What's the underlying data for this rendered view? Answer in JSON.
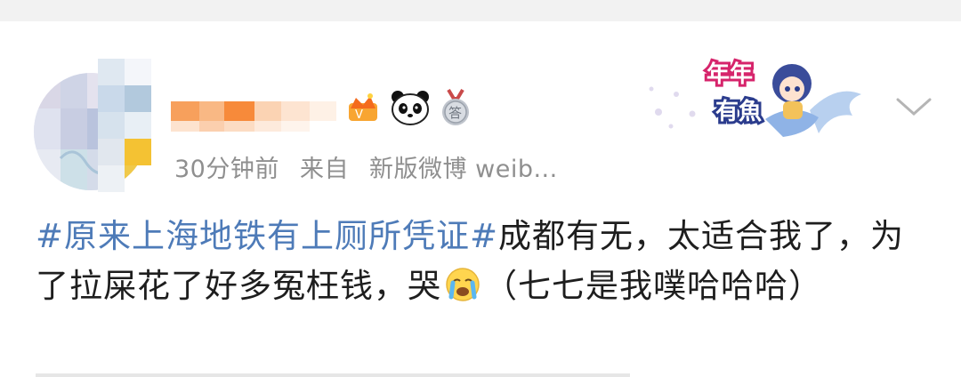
{
  "post": {
    "time": "30分钟前",
    "source_prefix": "来自",
    "source": "新版微博 weib...",
    "hashtag": "#原来上海地铁有上厕所凭证#",
    "text_part1": "成都有无，太适合我了，为了拉屎花了好多冤枉钱，哭",
    "text_part2": "（七七是我噗哈哈哈）",
    "emoji": "crying-face-icon"
  },
  "decoration": {
    "label": "年年有魚"
  },
  "badges": [
    "crown-icon",
    "panda-icon",
    "medal-icon"
  ],
  "colors": {
    "hashtag": "#4e7bb8",
    "meta": "#8f8f8f",
    "text": "#1e1e1e",
    "background": "#ffffff",
    "page": "#f2f2f2"
  }
}
